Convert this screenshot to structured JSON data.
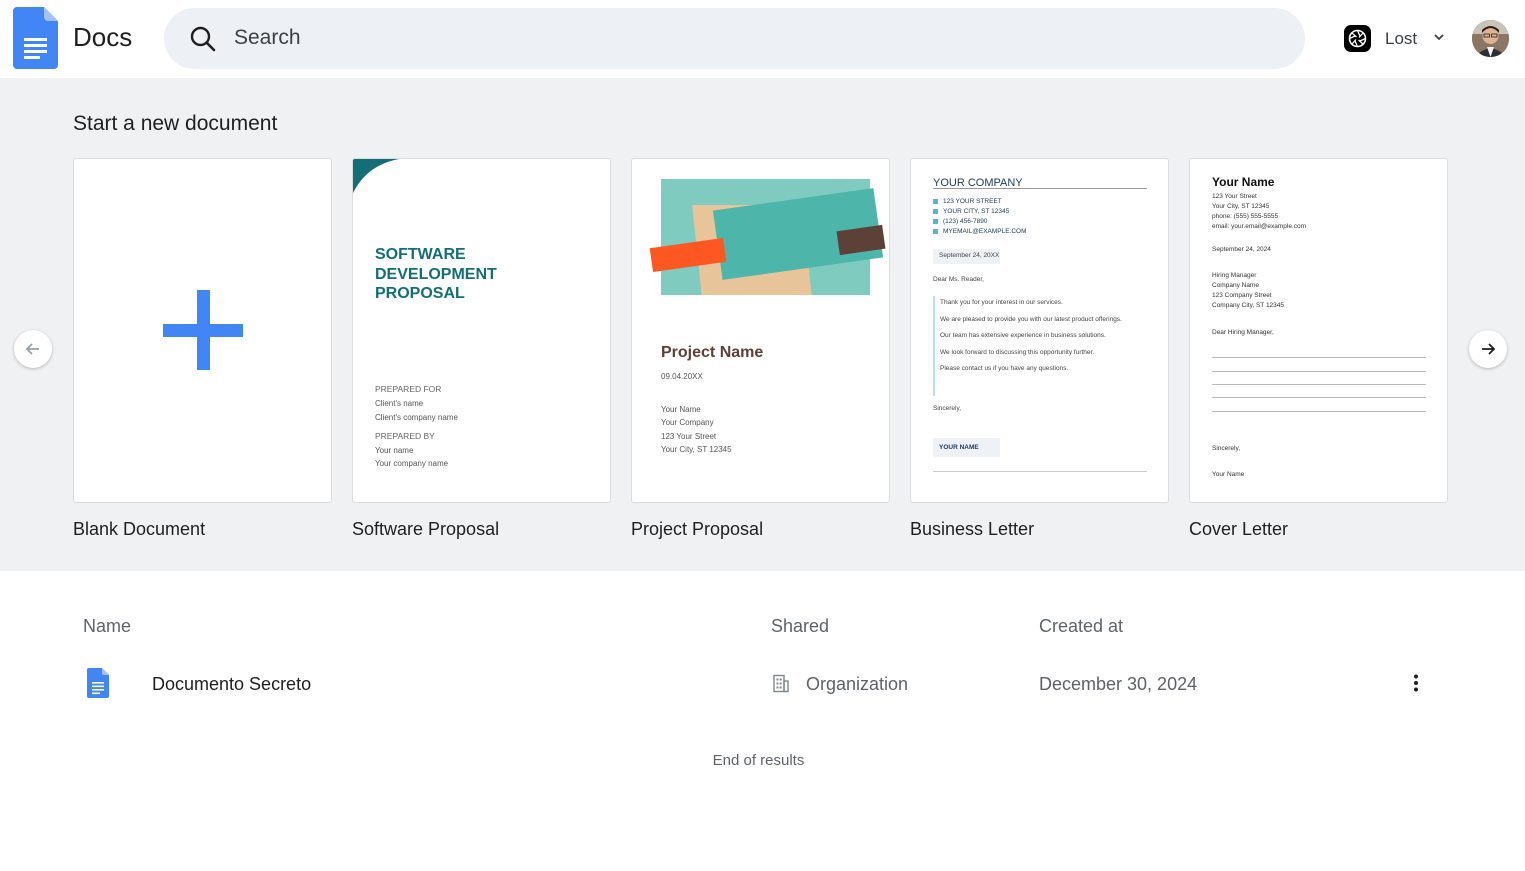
{
  "header": {
    "app_title": "Docs",
    "search_placeholder": "Search",
    "org_name": "Lost"
  },
  "templates": {
    "title": "Start a new document",
    "items": [
      {
        "label": "Blank Document"
      },
      {
        "label": "Software Proposal"
      },
      {
        "label": "Project Proposal"
      },
      {
        "label": "Business Letter"
      },
      {
        "label": "Cover Letter"
      }
    ],
    "software": {
      "title_lines": [
        "SOFTWARE",
        "DEVELOPMENT",
        "PROPOSAL"
      ],
      "prepared_for": "PREPARED FOR",
      "client_name": "Client's name",
      "client_company": "Client's company name",
      "prepared_by": "PREPARED BY",
      "your_name": "Your name",
      "your_company": "Your company name"
    },
    "project": {
      "title": "Project Name",
      "date": "09.04.20XX",
      "lines": [
        "Your Name",
        "Your Company",
        "123 Your Street",
        "Your City, ST 12345"
      ]
    },
    "business": {
      "company": "YOUR COMPANY",
      "list": [
        "123 YOUR STREET",
        "YOUR CITY, ST 12345",
        "(123) 456-7890",
        "MYEMAIL@EXAMPLE.COM"
      ],
      "date": "September 24, 20XX",
      "greeting": "Dear Ms. Reader,",
      "body": [
        "Thank you for your interest in our services.",
        "We are pleased to provide you with our latest product offerings.",
        "Our team has extensive experience in business solutions.",
        "We look forward to discussing this opportunity further.",
        "Please contact us if you have any questions."
      ],
      "closing": "Sincerely,",
      "name": "YOUR NAME"
    },
    "cover": {
      "name": "Your Name",
      "address": [
        "123 Your Street",
        "Your City, ST 12345",
        "phone: (555) 555-5555",
        "email: your.email@example.com"
      ],
      "date": "September 24, 2024",
      "recipient": [
        "Hiring Manager",
        "Company Name",
        "123 Company Street",
        "Company City, ST 12345"
      ],
      "greeting": "Dear Hiring Manager,",
      "closing": "Sincerely,",
      "signature": "Your Name"
    }
  },
  "table": {
    "headers": {
      "name": "Name",
      "shared": "Shared",
      "created": "Created at"
    },
    "rows": [
      {
        "name": "Documento Secreto",
        "shared": "Organization",
        "created": "December 30, 2024"
      }
    ],
    "end_text": "End of results"
  },
  "colors": {
    "accent": "#4285f4",
    "band_bg": "#f0f1f3",
    "search_bg": "#edf0f4",
    "teal": "#136f75"
  }
}
